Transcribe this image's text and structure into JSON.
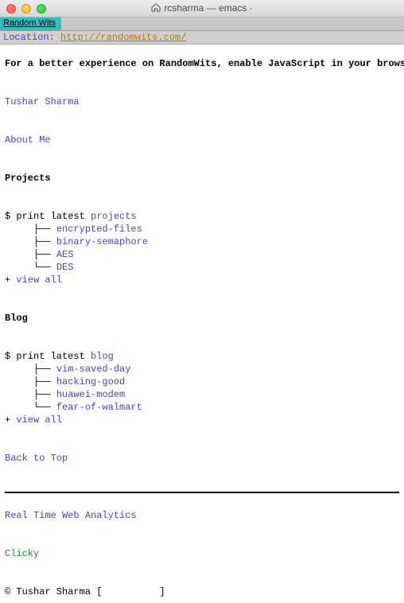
{
  "window": {
    "title": "rcsharma — emacs ·",
    "tab": "Random Wits",
    "location_label": "Location:",
    "location_url": "http://randomwits.com/"
  },
  "banner": "For a better experience on RandomWits, enable JavaScript in your browser",
  "author": "Tushar Sharma",
  "about": "About Me",
  "projects": {
    "heading": "Projects",
    "cmd_prefix": "$ print latest ",
    "cmd_arg": "projects",
    "items": [
      "encrypted-files",
      "binary-semaphore",
      "AES",
      "DES"
    ],
    "viewall_prefix": "+ ",
    "viewall": "view all"
  },
  "blog": {
    "heading": "Blog",
    "cmd_prefix": "$ print latest ",
    "cmd_arg": "blog",
    "items": [
      "vim-saved-day",
      "hacking-good",
      "huawei-modem",
      "fear-of-walmart"
    ],
    "viewall_prefix": "+ ",
    "viewall": "view all"
  },
  "backtotop": "Back to Top",
  "analytics": "Real Time Web Analytics",
  "clicky": "Clicky",
  "footer_prefix": "© Tushar Sharma [",
  "footer_suffix": "]",
  "tree": {
    "branch": "     ├── ",
    "last": "     └── "
  }
}
